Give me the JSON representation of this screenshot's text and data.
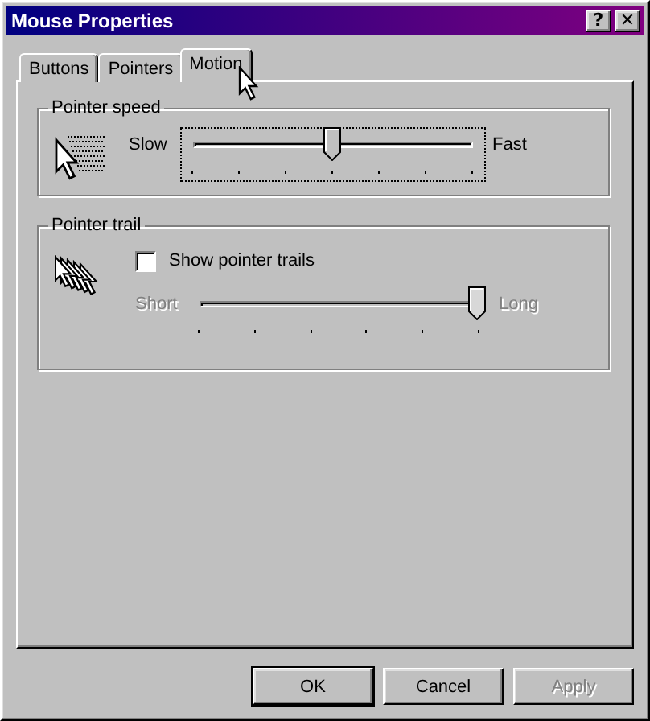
{
  "window": {
    "title": "Mouse Properties",
    "help_button": "?",
    "close_button": "✕"
  },
  "tabs": [
    {
      "label": "Buttons",
      "selected": false
    },
    {
      "label": "Pointers",
      "selected": false
    },
    {
      "label": "Motion",
      "selected": true
    }
  ],
  "pointer_speed": {
    "title": "Pointer speed",
    "slider": {
      "kind": "speed",
      "min_label": "Slow",
      "max_label": "Fast",
      "level": 0.5,
      "focused": true,
      "disabled": false
    }
  },
  "pointer_trail": {
    "title": "Pointer trail",
    "checkbox": {
      "label": "Show pointer trails",
      "checked": false
    },
    "slider": {
      "kind": "trail",
      "min_label": "Short",
      "max_label": "Long",
      "level": 1,
      "focused": false,
      "disabled": true
    }
  },
  "buttons": [
    {
      "label": "OK",
      "disabled": false
    },
    {
      "label": "Cancel",
      "disabled": false
    },
    {
      "label": "Apply",
      "disabled": true
    }
  ]
}
